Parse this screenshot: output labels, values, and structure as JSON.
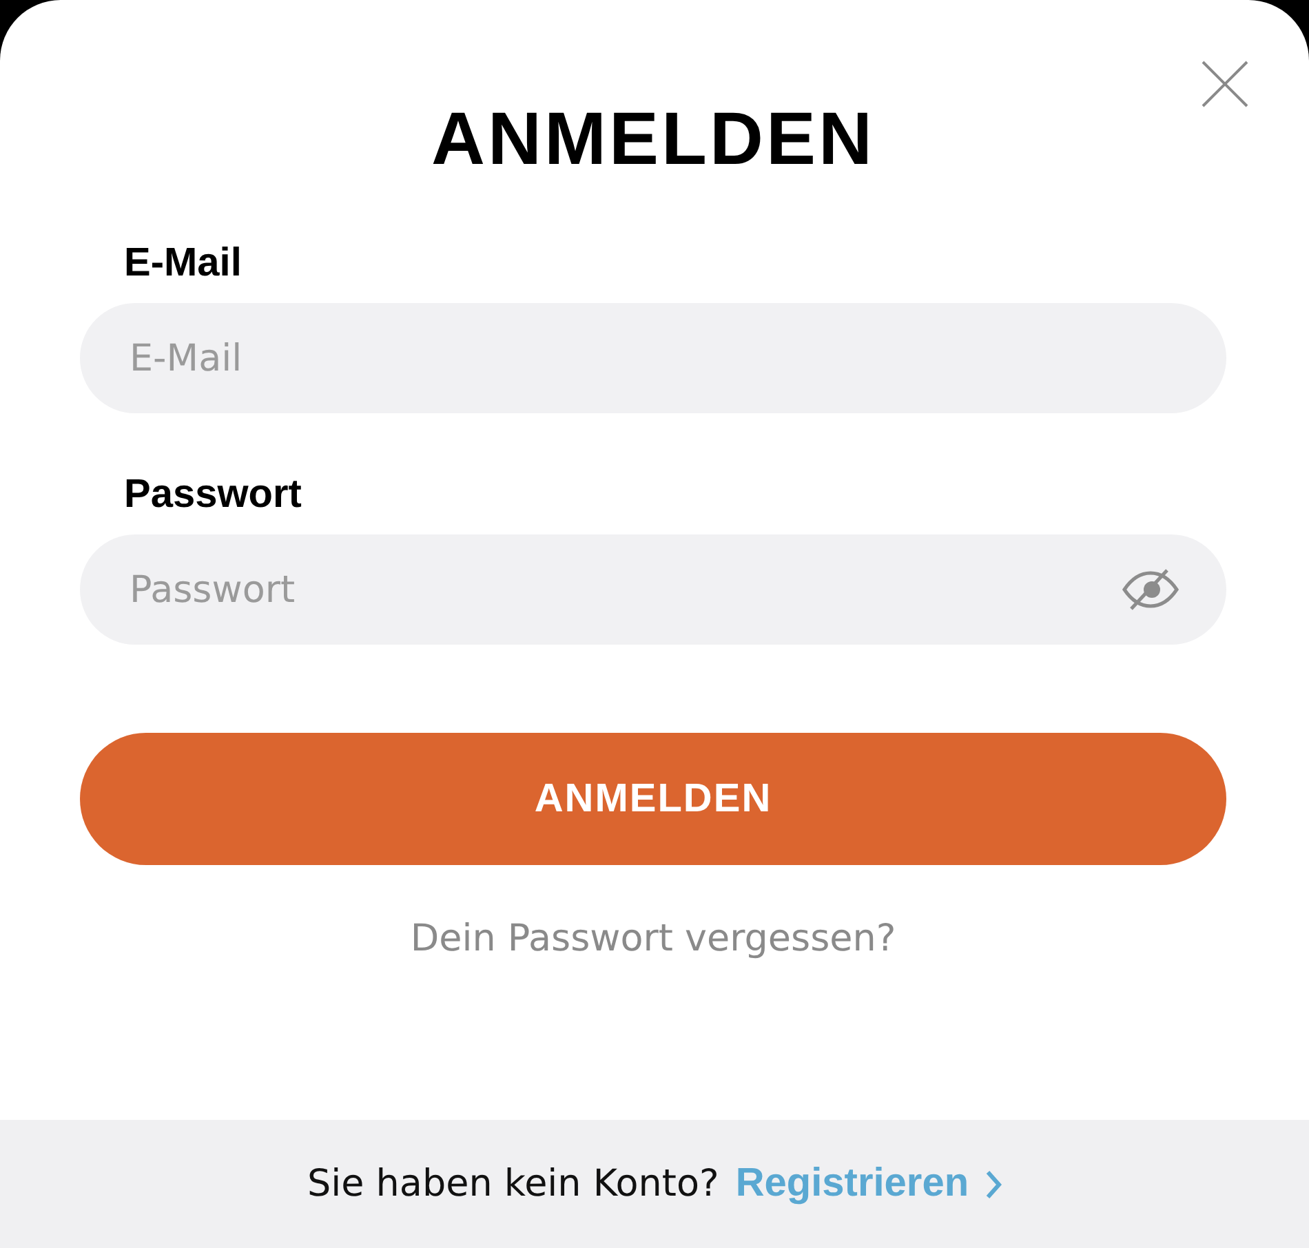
{
  "dialog": {
    "title": "ANMELDEN"
  },
  "fields": [
    {
      "label": "E-Mail",
      "placeholder": "E-Mail",
      "kind": "text"
    },
    {
      "label": "Passwort",
      "placeholder": "Passwort",
      "kind": "password"
    }
  ],
  "submit_button": "ANMELDEN",
  "forgot_link": "Dein Passwort vergessen?",
  "footer": {
    "text": "Sie haben kein Konto?",
    "link": "Registrieren"
  }
}
